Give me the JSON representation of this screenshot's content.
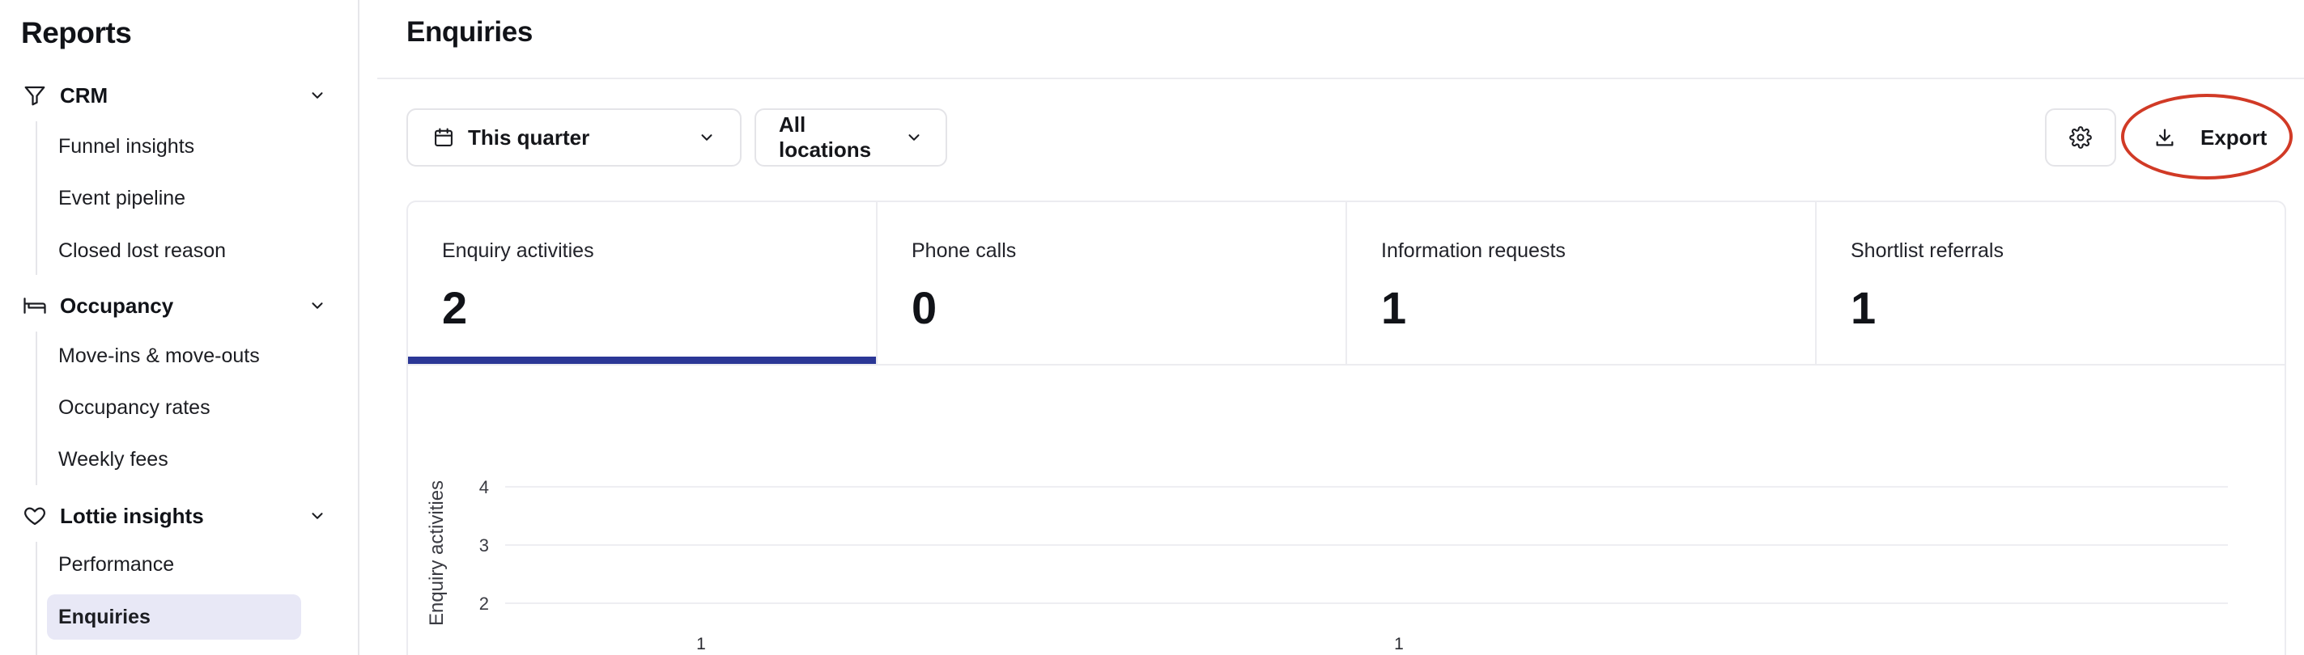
{
  "sidebar": {
    "title": "Reports",
    "sections": [
      {
        "label": "CRM",
        "icon": "filter-icon",
        "items": [
          "Funnel insights",
          "Event pipeline",
          "Closed lost reason"
        ]
      },
      {
        "label": "Occupancy",
        "icon": "bed-icon",
        "items": [
          "Move-ins & move-outs",
          "Occupancy rates",
          "Weekly fees"
        ]
      },
      {
        "label": "Lottie insights",
        "icon": "heart-icon",
        "items": [
          "Performance",
          "Enquiries"
        ]
      }
    ],
    "active_item": "Enquiries"
  },
  "header": {
    "title": "Enquiries"
  },
  "filters": {
    "date_range": "This quarter",
    "location": "All locations"
  },
  "toolbar": {
    "export_label": "Export"
  },
  "stats": [
    {
      "label": "Enquiry activities",
      "value": "2",
      "active": true
    },
    {
      "label": "Phone calls",
      "value": "0",
      "active": false
    },
    {
      "label": "Information requests",
      "value": "1",
      "active": false
    },
    {
      "label": "Shortlist referrals",
      "value": "1",
      "active": false
    }
  ],
  "chart_data": {
    "type": "bar",
    "ylabel": "Enquiry activities",
    "y_ticks": [
      2,
      3,
      4
    ],
    "data_labels": [
      {
        "label": "1"
      },
      {
        "label": "1"
      }
    ]
  },
  "colors": {
    "accent": "#2b3796",
    "highlight": "#d13a26",
    "active_nav_bg": "#e8e8f6"
  }
}
